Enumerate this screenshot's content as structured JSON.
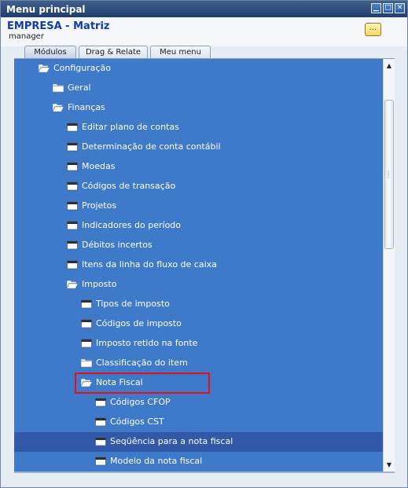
{
  "window": {
    "title": "Menu principal",
    "minimize": "▁",
    "maximize": "□",
    "close": "✕"
  },
  "header": {
    "company": "EMPRESA - Matriz",
    "user": "manager",
    "more_label": "..."
  },
  "tabs": [
    {
      "label": "Módulos",
      "active": true
    },
    {
      "label": "Drag & Relate",
      "active": false
    },
    {
      "label": "Meu menu",
      "active": false
    }
  ],
  "tree": {
    "items": [
      {
        "label": "Configuração",
        "icon": "folder-open-icon",
        "level": 1
      },
      {
        "label": "Geral",
        "icon": "folder-icon",
        "level": 2
      },
      {
        "label": "Finanças",
        "icon": "folder-open-icon",
        "level": 2
      },
      {
        "label": "Editar plano de contas",
        "icon": "window-icon",
        "level": 3
      },
      {
        "label": "Determinação de conta contábil",
        "icon": "window-icon",
        "level": 3
      },
      {
        "label": "Moedas",
        "icon": "window-icon",
        "level": 3
      },
      {
        "label": "Códigos de transação",
        "icon": "window-icon",
        "level": 3
      },
      {
        "label": "Projetos",
        "icon": "window-icon",
        "level": 3
      },
      {
        "label": "Indicadores do período",
        "icon": "window-icon",
        "level": 3
      },
      {
        "label": "Débitos incertos",
        "icon": "window-icon",
        "level": 3
      },
      {
        "label": "Itens da linha do fluxo de caixa",
        "icon": "window-icon",
        "level": 3
      },
      {
        "label": "Imposto",
        "icon": "folder-open-icon",
        "level": 3
      },
      {
        "label": "Tipos de imposto",
        "icon": "window-icon",
        "level": 4
      },
      {
        "label": "Códigos de imposto",
        "icon": "window-icon",
        "level": 4
      },
      {
        "label": "Imposto retido na fonte",
        "icon": "window-icon",
        "level": 4
      },
      {
        "label": "Classificação do item",
        "icon": "folder-icon",
        "level": 4
      },
      {
        "label": "Nota Fiscal",
        "icon": "folder-open-icon",
        "level": 4
      },
      {
        "label": "Códigos CFOP",
        "icon": "window-icon",
        "level": 5
      },
      {
        "label": "Códigos CST",
        "icon": "window-icon",
        "level": 5
      },
      {
        "label": "Seqüência para a nota fiscal",
        "icon": "window-icon",
        "level": 5,
        "selected": true
      },
      {
        "label": "Modelo da nota fiscal",
        "icon": "window-icon",
        "level": 5
      }
    ]
  },
  "colors": {
    "tree_bg": "#3f79c9",
    "selected_bg": "#3159a8",
    "highlight_border": "#e21218",
    "company_text": "#0f3ea8"
  }
}
